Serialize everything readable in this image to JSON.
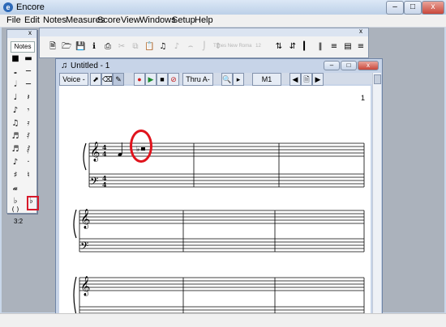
{
  "app": {
    "title": "Encore",
    "menus": [
      "File",
      "Edit",
      "Notes",
      "Measures",
      "Score",
      "View",
      "Windows",
      "Setup",
      "Help"
    ]
  },
  "notes_palette": {
    "title": "Notes",
    "tuplet_label": "3:2",
    "close_glyph": "x"
  },
  "toolbar": {
    "close_glyph": "x",
    "font_name": "Times New Roma",
    "font_size": "12"
  },
  "document": {
    "title": "Untitled - 1",
    "voice_label": "Voice -",
    "thru_label": "Thru A-",
    "measure_label": "M1",
    "page_number": "1"
  },
  "colors": {
    "highlight": "#e0131c",
    "titlebar": "#c9d7ea"
  }
}
